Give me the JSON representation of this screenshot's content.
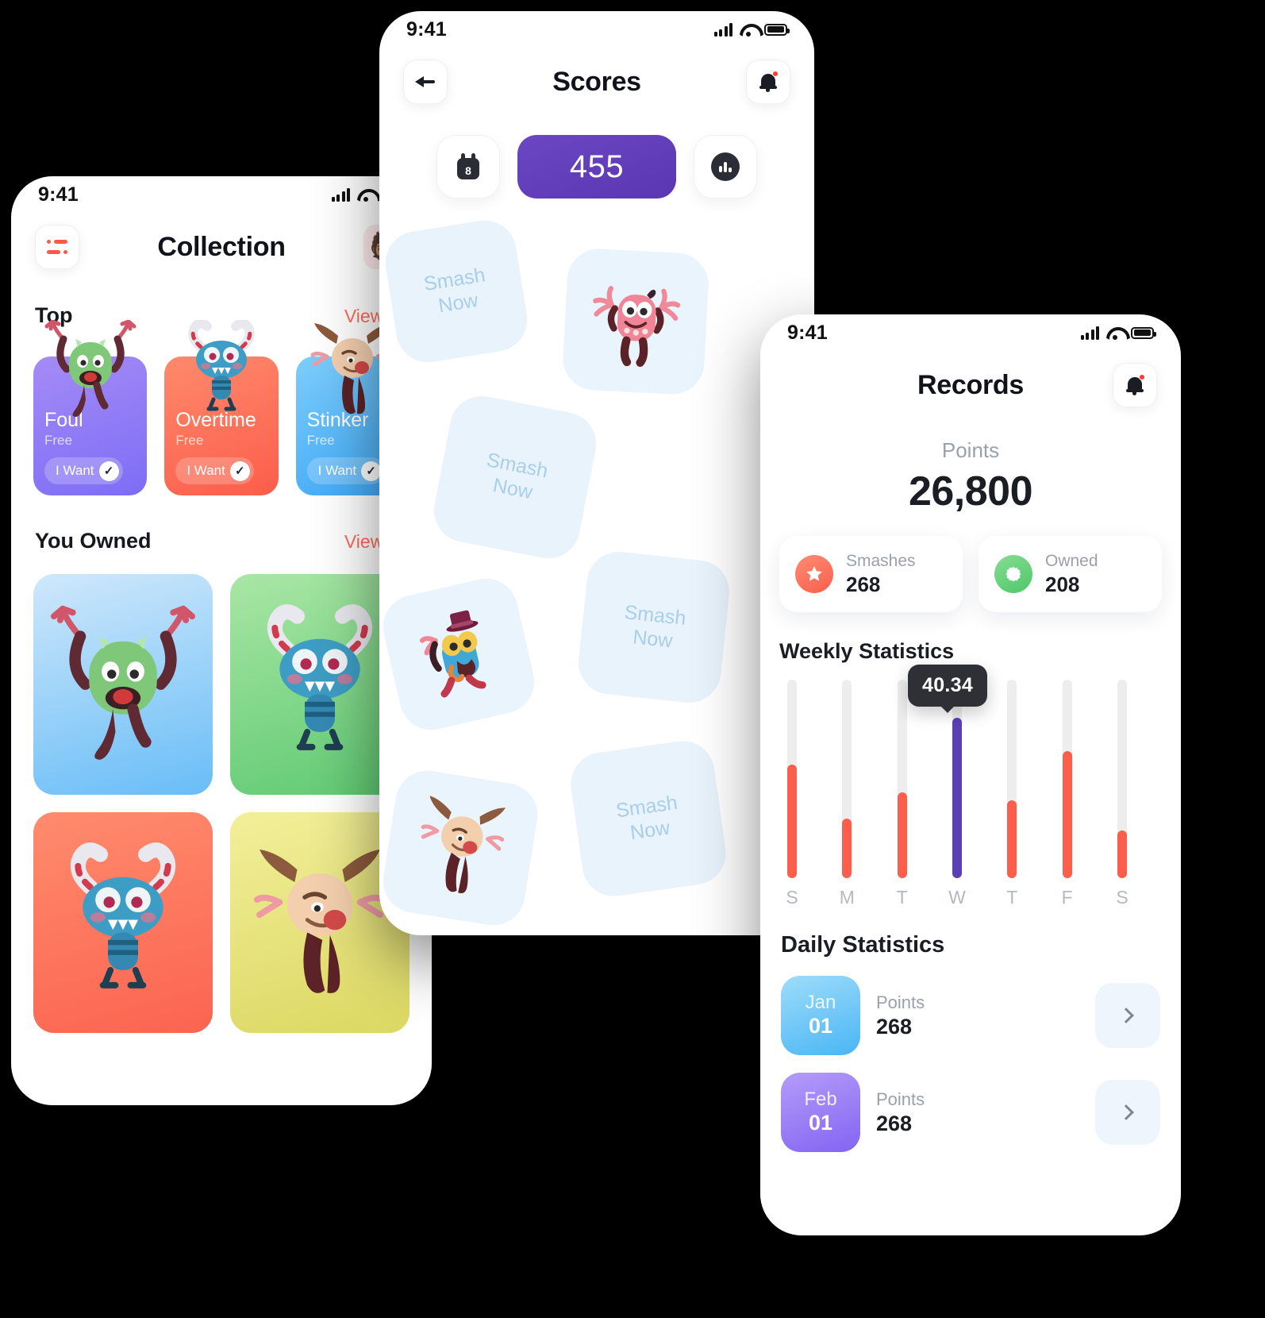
{
  "collection": {
    "status": {
      "time": "9:41"
    },
    "nav": {
      "title": "Collection",
      "menu_icon": "menu-icon",
      "avatar_icon": "avatar-memoji"
    },
    "top_section": {
      "title": "Top",
      "view_all": "View All"
    },
    "top_cards": [
      {
        "name": "Foul",
        "price": "Free",
        "cta": "I Want",
        "check": "✓",
        "color": "#7d6df5",
        "monster": "green-monster"
      },
      {
        "name": "Overtime",
        "price": "Free",
        "cta": "I Want",
        "check": "✓",
        "color": "#fb5d4b",
        "monster": "blue-candy-monster"
      },
      {
        "name": "Stinker",
        "price": "Free",
        "cta": "I Want",
        "check": "✓",
        "color": "#3fa8f7",
        "monster": "beige-ears-monster"
      }
    ],
    "owned_section": {
      "title": "You Owned",
      "view_all": "View All"
    },
    "owned_cards": [
      {
        "monster": "green-monster",
        "bg": "#68bdf7"
      },
      {
        "monster": "blue-candy-monster",
        "bg": "#5fca72"
      },
      {
        "monster": "blue-candy-monster",
        "bg": "#fb6450"
      },
      {
        "monster": "beige-ears-monster",
        "bg": "#dbd862"
      }
    ]
  },
  "scores": {
    "status": {
      "time": "9:41"
    },
    "nav": {
      "title": "Scores",
      "back_icon": "back-arrow-icon",
      "bell_icon": "bell-icon"
    },
    "controls": {
      "calendar_day": "8",
      "score": "455",
      "chart_icon": "bar-chart-icon"
    },
    "tiles": [
      {
        "label": "Smash\nNow",
        "type": "text"
      },
      {
        "label": "",
        "type": "monster",
        "monster": "pink-monster"
      },
      {
        "label": "Smash\nNow",
        "type": "text"
      },
      {
        "label": "",
        "type": "monster",
        "monster": "tophat-monster"
      },
      {
        "label": "Smash\nNow",
        "type": "text"
      },
      {
        "label": "",
        "type": "monster",
        "monster": "beige-ears-monster"
      },
      {
        "label": "Smash\nNow",
        "type": "text"
      }
    ],
    "tile_text_line1": "Smash",
    "tile_text_line2": "Now"
  },
  "records": {
    "status": {
      "time": "9:41"
    },
    "nav": {
      "title": "Records",
      "bell_icon": "bell-icon"
    },
    "points_label": "Points",
    "points_value": "26,800",
    "stats": [
      {
        "label": "Smashes",
        "value": "268",
        "icon": "star-icon",
        "color": "#fb5f4b"
      },
      {
        "label": "Owned",
        "value": "208",
        "icon": "flower-icon",
        "color": "#4ec76a"
      }
    ],
    "weekly_title": "Weekly Statistics",
    "daily_title": "Daily Statistics",
    "daily_rows": [
      {
        "month": "Jan",
        "day": "01",
        "label": "Points",
        "value": "268",
        "chevron": "chevron-right-icon"
      },
      {
        "month": "Feb",
        "day": "01",
        "label": "Points",
        "value": "268",
        "chevron": "chevron-right-icon"
      }
    ]
  },
  "chart_data": {
    "type": "bar",
    "title": "Weekly Statistics",
    "categories": [
      "S",
      "M",
      "T",
      "W",
      "T",
      "F",
      "S"
    ],
    "values": [
      28.5,
      15.0,
      21.5,
      40.34,
      19.5,
      32.0,
      12.0
    ],
    "highlight_index": 3,
    "highlight_label": "40.34",
    "ylim": [
      0,
      50
    ],
    "xlabel": "",
    "ylabel": "",
    "grid": false,
    "legend": "none",
    "colors": {
      "bar": "#fb5f4b",
      "highlight": "#5b3fb5",
      "track": "#ededee"
    }
  }
}
